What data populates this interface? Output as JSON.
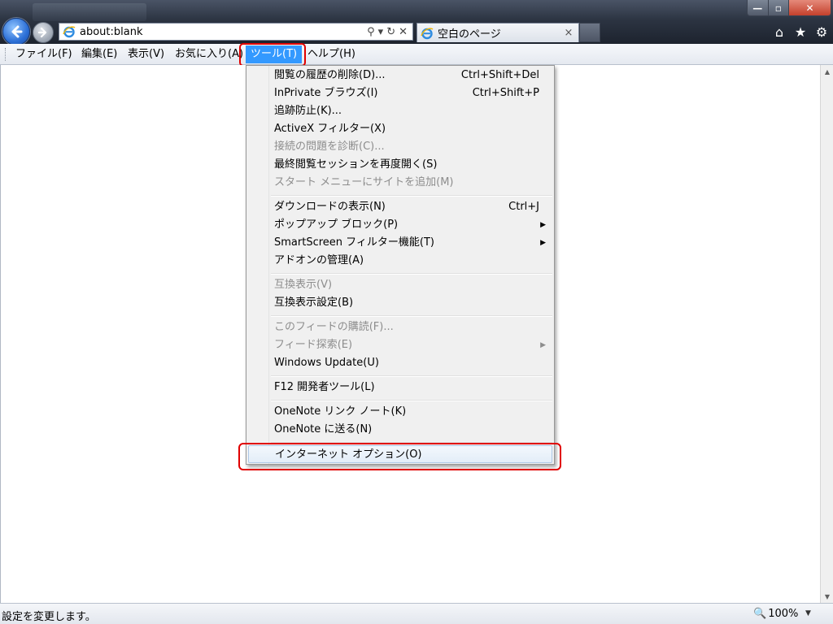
{
  "window": {
    "address": "about:blank",
    "tab_title": "空白のページ",
    "tab_close": "×",
    "address_tools": [
      "⚲",
      "▾",
      "↻",
      "✕"
    ],
    "controls": {
      "minimize": "—",
      "maximize": "▫",
      "close": "✕"
    },
    "right_icons": [
      "⌂",
      "★",
      "⚙"
    ]
  },
  "menubar": {
    "items": [
      "ファイル(F)",
      "編集(E)",
      "表示(V)",
      "お気に入り(A)",
      "ツール(T)",
      "ヘルプ(H)"
    ],
    "active": "ツール(T)"
  },
  "tools_menu": {
    "items": [
      {
        "label": "閲覧の履歴の削除(D)...",
        "shortcut": "Ctrl+Shift+Del",
        "enabled": true
      },
      {
        "label": "InPrivate ブラウズ(I)",
        "shortcut": "Ctrl+Shift+P",
        "enabled": true
      },
      {
        "label": "追跡防止(K)...",
        "enabled": true
      },
      {
        "label": "ActiveX フィルター(X)",
        "enabled": true
      },
      {
        "label": "接続の問題を診断(C)...",
        "enabled": false
      },
      {
        "label": "最終閲覧セッションを再度開く(S)",
        "enabled": true
      },
      {
        "label": "スタート メニューにサイトを追加(M)",
        "enabled": false
      },
      {
        "label": "ダウンロードの表示(N)",
        "shortcut": "Ctrl+J",
        "enabled": true
      },
      {
        "label": "ポップアップ ブロック(P)",
        "submenu": true,
        "enabled": true
      },
      {
        "label": "SmartScreen フィルター機能(T)",
        "submenu": true,
        "enabled": true
      },
      {
        "label": "アドオンの管理(A)",
        "enabled": true
      },
      {
        "label": "互換表示(V)",
        "enabled": false
      },
      {
        "label": "互換表示設定(B)",
        "enabled": true
      },
      {
        "label": "このフィードの購読(F)...",
        "enabled": false
      },
      {
        "label": "フィード探索(E)",
        "submenu": true,
        "enabled": false
      },
      {
        "label": "Windows Update(U)",
        "enabled": true
      },
      {
        "label": "F12 開発者ツール(L)",
        "enabled": true
      },
      {
        "label": "OneNote リンク ノート(K)",
        "enabled": true
      },
      {
        "label": "OneNote に送る(N)",
        "enabled": true
      },
      {
        "label": "インターネット オプション(O)",
        "enabled": true,
        "selected": true
      }
    ],
    "submenu_arrow": "▶"
  },
  "status": {
    "text": "設定を変更します。",
    "zoom": "100%",
    "zoom_icon": "🔍",
    "zoom_dropdown": "▼"
  },
  "colors": {
    "highlight_frame": "#e00000",
    "menu_active": "#3399ff"
  }
}
